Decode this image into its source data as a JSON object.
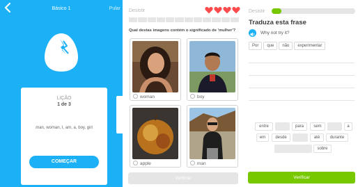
{
  "screen1": {
    "nav": {
      "title": "Básico 1",
      "skip_label": "Pular"
    },
    "card": {
      "lesson_label": "LIÇÃO",
      "lesson_count": "1 de 3",
      "words": "man, woman, I, am, a, boy, girl",
      "start_label": "COMEÇAR"
    },
    "colors": {
      "background": "#1cb0f6",
      "accent": "#1cb0f6"
    }
  },
  "screen2": {
    "quit_label": "Desistir",
    "hearts": 4,
    "progress_filled": 0,
    "question": "Qual destas imagens contém o significado de 'mulher'?",
    "options": [
      {
        "label": "woman",
        "icon": "woman-photo"
      },
      {
        "label": "boy",
        "icon": "boy-photo"
      },
      {
        "label": "apple",
        "icon": "apple-photo"
      },
      {
        "label": "man",
        "icon": "man-photo"
      }
    ],
    "verify_label": "Verificar",
    "colors": {
      "heart": "#ff4b4b",
      "disabled": "#e5e5e5"
    }
  },
  "screen3": {
    "quit_label": "Desistir",
    "progress": 0.12,
    "heading": "Traduza esta frase",
    "sentence": "Why not try it?",
    "hints": [
      "Por",
      "que",
      "não",
      "experimentar"
    ],
    "word_bank": {
      "row1": [
        "entre",
        "para",
        "sem",
        "a"
      ],
      "row2": [
        "em",
        "desde",
        "até",
        "durante"
      ],
      "row3": [
        "sobre"
      ]
    },
    "verify_label": "Verificar",
    "colors": {
      "progress": "#78c800",
      "button": "#78c800"
    }
  }
}
